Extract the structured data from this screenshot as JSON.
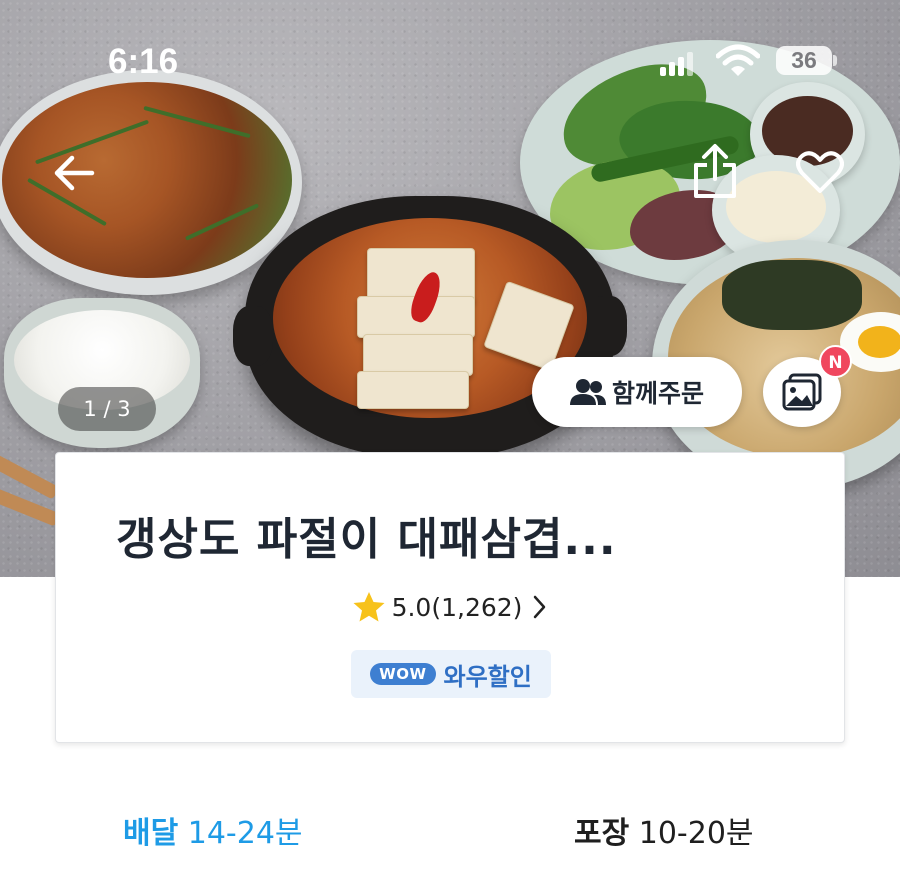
{
  "status_bar": {
    "time": "6:16",
    "battery_level": "36"
  },
  "hero": {
    "page_indicator": "1 / 3",
    "together_order_label": "함께주문",
    "new_badge": "N"
  },
  "store": {
    "name": "갱상도 파절이 대패삼겹...",
    "rating": "5.0(1,262)",
    "wow_logo": "WOW",
    "wow_label": "와우할인"
  },
  "delivery": {
    "delivery_label": "배달",
    "delivery_time": "14-24분",
    "pickup_label": "포장",
    "pickup_time": "10-20분"
  },
  "colors": {
    "accent_blue": "#1e9be6",
    "wow_blue": "#3e7fd1",
    "badge_red": "#f0475e",
    "star_yellow": "#f7c21b"
  },
  "icons": [
    "back-arrow-icon",
    "share-icon",
    "heart-icon",
    "people-icon",
    "photo-review-icon",
    "star-icon",
    "chevron-right-icon",
    "signal-icon",
    "wifi-icon",
    "battery-icon"
  ]
}
